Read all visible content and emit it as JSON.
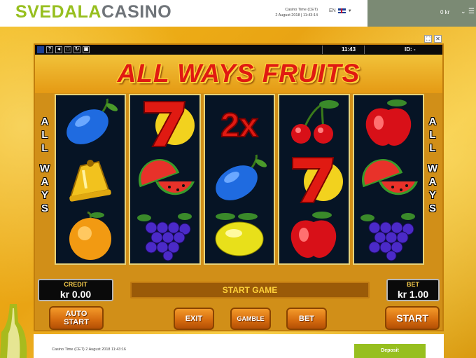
{
  "site": {
    "logo_part1": "SVEDALA",
    "logo_part2": "CASINO",
    "casino_time_label": "Casino Time (CET)",
    "casino_time_value": "2 August 2018 | 11:43:14",
    "language": "EN",
    "balance": "0 kr",
    "deposit_label": "Deposit",
    "footer_time": "Casino Time (CET) 2 August 2018  11:43:16"
  },
  "popup": {
    "controls": [
      "⛶",
      "✕"
    ]
  },
  "game": {
    "topbar": {
      "icons": [
        "help-icon",
        "sound-icon",
        "fullscreen-icon",
        "reload-icon",
        "settings-icon"
      ],
      "help": "?",
      "sound": "◄",
      "time": "11:43",
      "id_label": "ID: -"
    },
    "title": "ALL WAYS FRUITS",
    "side_left": [
      "A",
      "L",
      "L",
      "W",
      "A",
      "Y",
      "S"
    ],
    "side_right": [
      "A",
      "L",
      "L",
      "W",
      "A",
      "Y",
      "S"
    ],
    "reels": [
      [
        "plum",
        "bell",
        "orange"
      ],
      [
        "seven",
        "watermelon",
        "grapes"
      ],
      [
        "multiplier-2x",
        "plum",
        "lemon"
      ],
      [
        "cherries",
        "seven",
        "apple"
      ],
      [
        "apple",
        "watermelon",
        "grapes"
      ]
    ],
    "multiplier_text": "2x",
    "credit_label": "CREDIT",
    "credit_value": "kr 0.00",
    "bet_label": "BET",
    "bet_value": "kr 1.00",
    "status": "START GAME",
    "buttons": {
      "auto_start_line1": "AUTO",
      "auto_start_line2": "START",
      "exit": "EXIT",
      "gamble": "GAMBLE",
      "bet": "BET",
      "start": "START"
    }
  },
  "colors": {
    "brand_green": "#97bf1f",
    "brand_grey": "#6f7479",
    "title_red": "#e01a12",
    "button_orange": "#e07a18"
  }
}
